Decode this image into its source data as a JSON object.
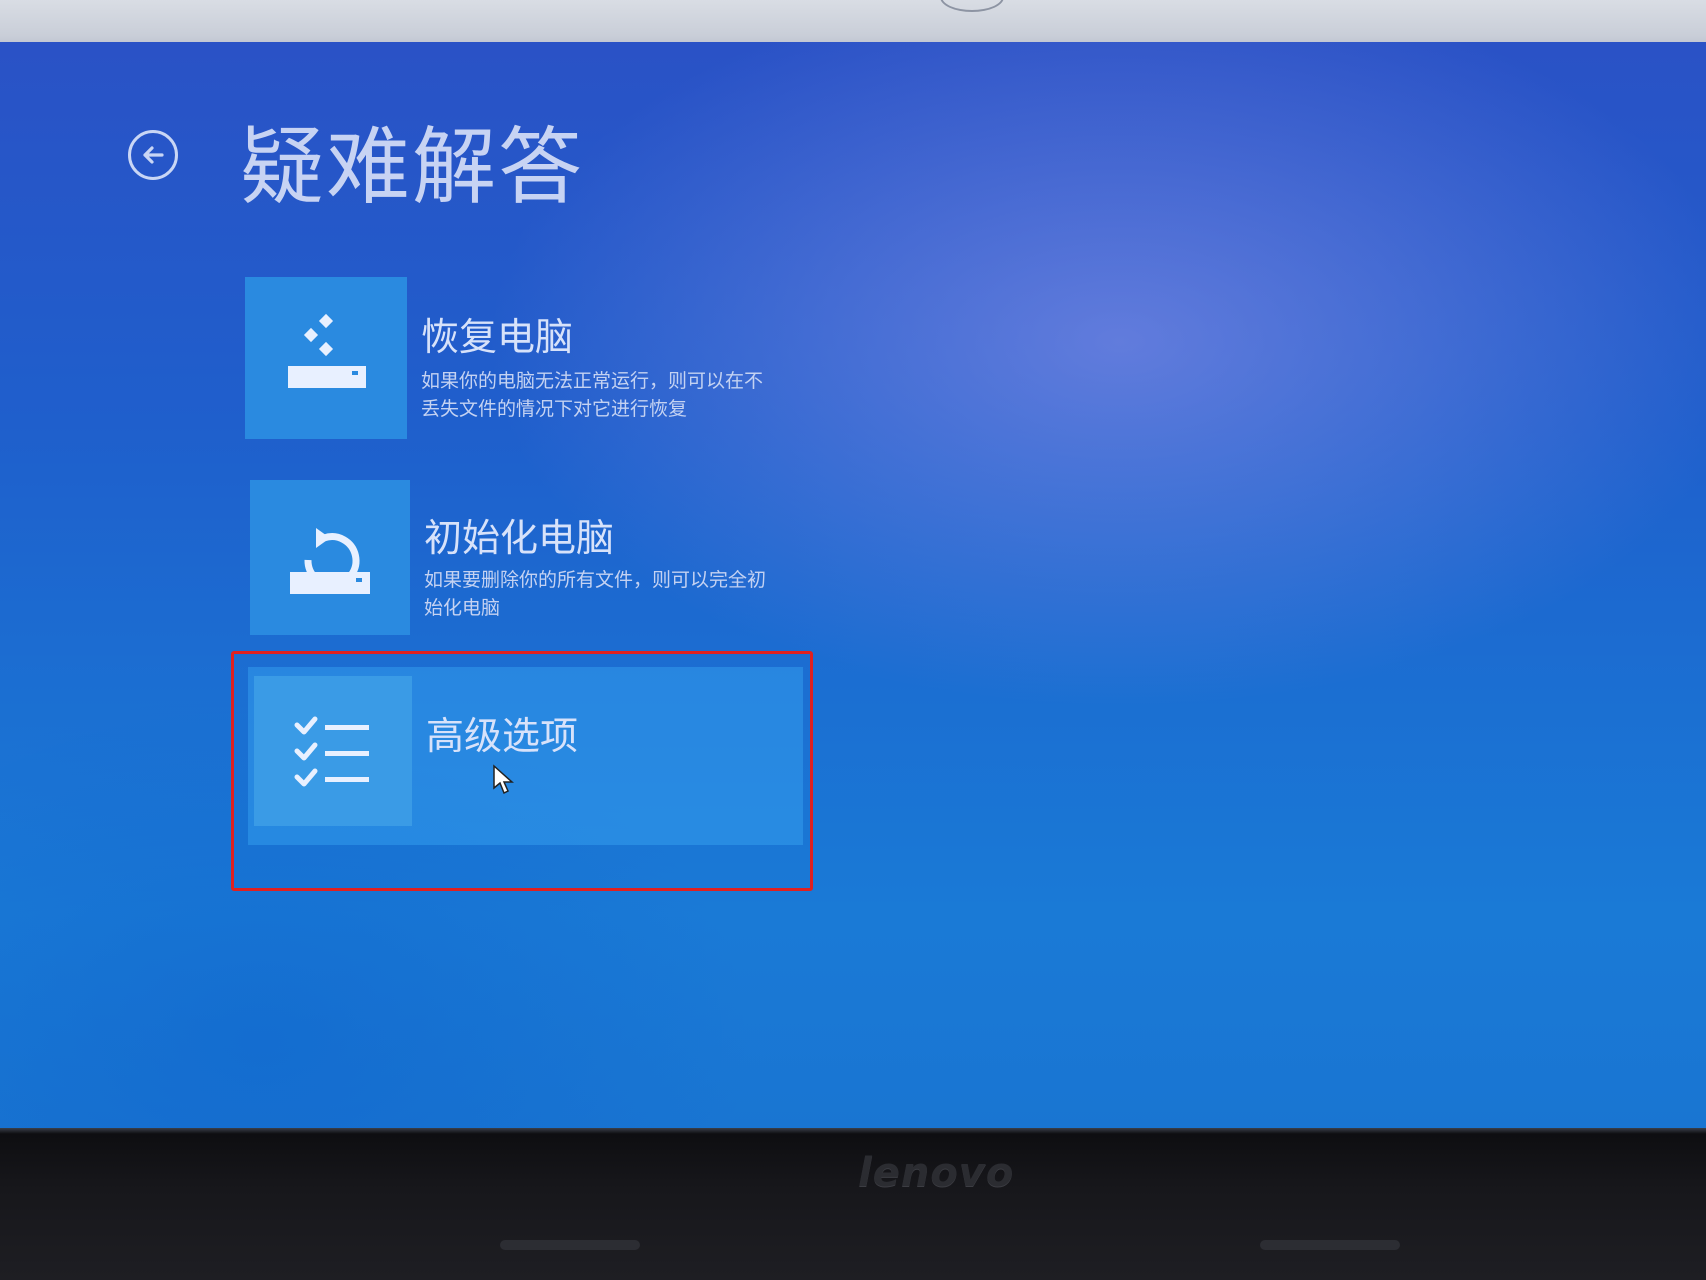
{
  "header": {
    "back_icon": "back-arrow-icon",
    "title": "疑难解答"
  },
  "options": [
    {
      "title": "恢复电脑",
      "description": "如果你的电脑无法正常运行，则可以在不丢失文件的情况下对它进行恢复",
      "icon": "refresh-pc-icon"
    },
    {
      "title": "初始化电脑",
      "description": "如果要删除你的所有文件，则可以完全初始化电脑",
      "icon": "reset-pc-icon"
    },
    {
      "title": "高级选项",
      "description": "",
      "icon": "checklist-icon",
      "selected": true
    }
  ],
  "bezel": {
    "brand": "lenovo"
  },
  "colors": {
    "screen_blue": "#1f5fcc",
    "tile": "#2a8ae0",
    "highlight": "#e02020",
    "text": "#d7e2fa"
  }
}
